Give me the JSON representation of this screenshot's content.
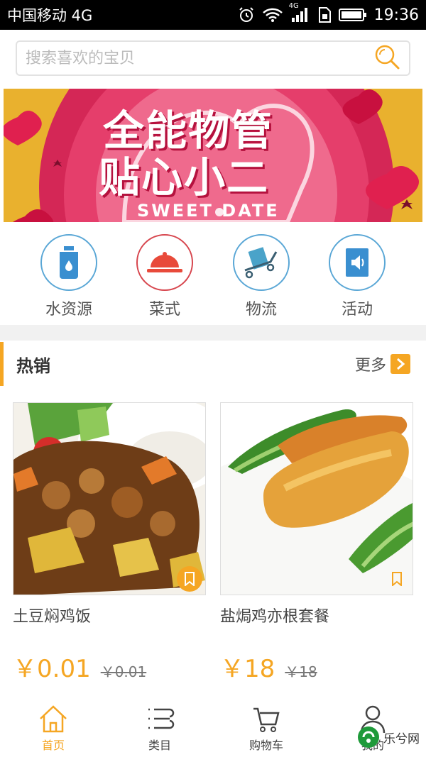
{
  "status_bar": {
    "carrier": "中国移动 4G",
    "network_label": "4G",
    "time": "19:36"
  },
  "search": {
    "placeholder": "搜索喜欢的宝贝"
  },
  "banner": {
    "line1": "全能物管",
    "line2": "贴心小二",
    "sub": "SWEET DATE"
  },
  "categories": [
    {
      "label": "水资源",
      "icon": "water-bottle-icon"
    },
    {
      "label": "菜式",
      "icon": "food-cloche-icon"
    },
    {
      "label": "物流",
      "icon": "hand-truck-icon"
    },
    {
      "label": "活动",
      "icon": "announcement-icon"
    }
  ],
  "hot": {
    "title": "热销",
    "more": "更多"
  },
  "products": [
    {
      "name": "土豆焖鸡饭",
      "price": "￥0.01",
      "old_price": "￥0.01"
    },
    {
      "name": "盐焗鸡亦根套餐",
      "price": "￥18",
      "old_price": "￥18"
    }
  ],
  "bottom_nav": [
    {
      "label": "首页",
      "icon": "home-icon",
      "active": true
    },
    {
      "label": "类目",
      "icon": "category-list-icon",
      "active": false
    },
    {
      "label": "购物车",
      "icon": "cart-icon",
      "active": false
    },
    {
      "label": "我的",
      "icon": "user-icon",
      "active": false
    }
  ],
  "watermark": {
    "text": "乐兮网"
  },
  "colors": {
    "accent": "#f5a623",
    "category_blue": "#5aa7d6",
    "category_red": "#d7464e"
  }
}
